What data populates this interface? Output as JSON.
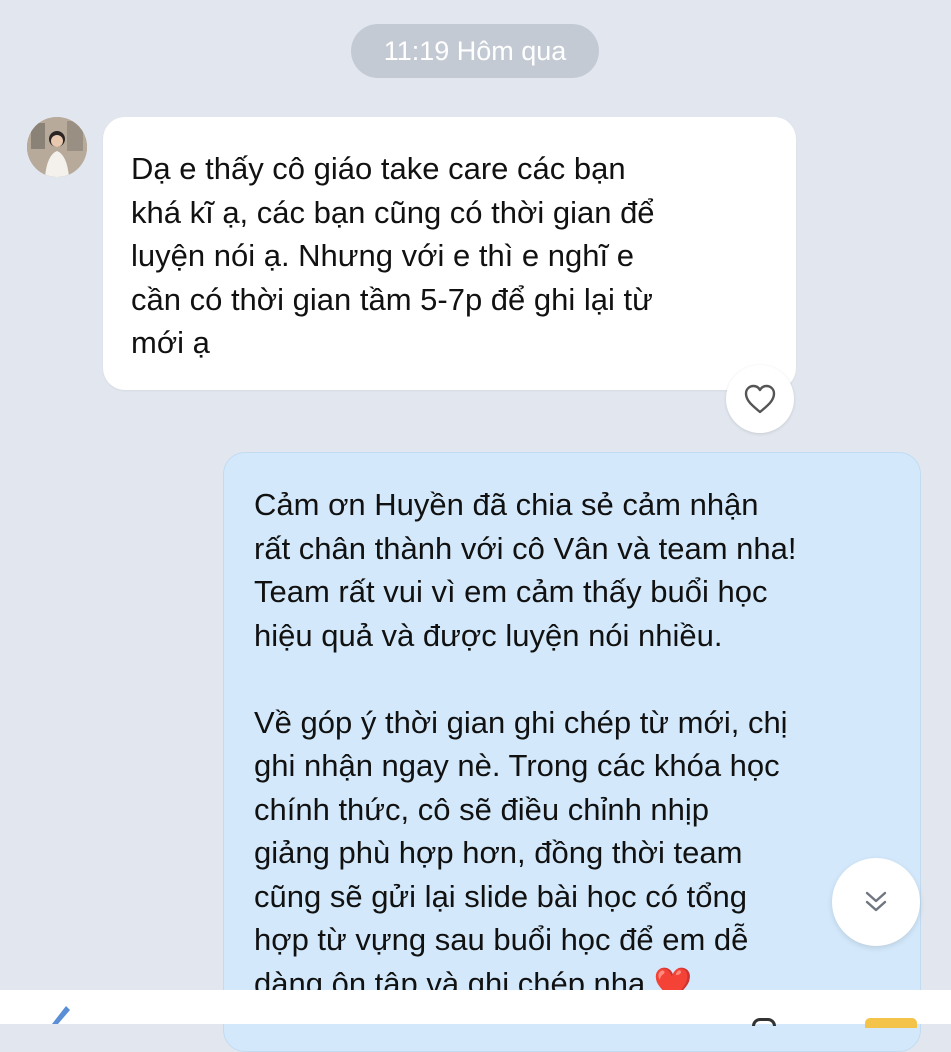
{
  "chat": {
    "timestamp": "11:19 Hôm qua",
    "incoming": {
      "text": "Dạ e thấy cô giáo take care các bạn\nkhá kĩ ạ, các bạn cũng có thời gian để\nluyện nói ạ. Nhưng với e thì e nghĩ e\ncần có thời gian tầm 5-7p để ghi lại từ\nmới ạ"
    },
    "outgoing": {
      "text": "Cảm ơn Huyền đã chia sẻ cảm nhận\nrất chân thành với cô Vân và team nha!\nTeam rất vui vì em cảm thấy buổi học\nhiệu quả và được luyện nói nhiều.\n\nVề góp ý thời gian ghi chép từ mới, chị\nghi nhận ngay nè. Trong các khóa học\nchính thức, cô sẽ điều chỉnh nhịp\ngiảng phù hợp hơn, đồng thời team\ncũng sẽ gửi lại slide bài học có tổng\nhợp từ vựng sau buổi học để em dễ\ndàng ôn tập và ghi chép nha ❤️"
    }
  },
  "icons": {
    "react": "heart-outline-icon",
    "scroll": "double-chevron-down-icon",
    "avatar": "contact-avatar"
  },
  "colors": {
    "background": "#e2e7ef",
    "incoming_bubble": "#ffffff",
    "outgoing_bubble": "#d3e9fb",
    "timestamp_pill": "#c4cad3",
    "heart": "#e0102b"
  }
}
